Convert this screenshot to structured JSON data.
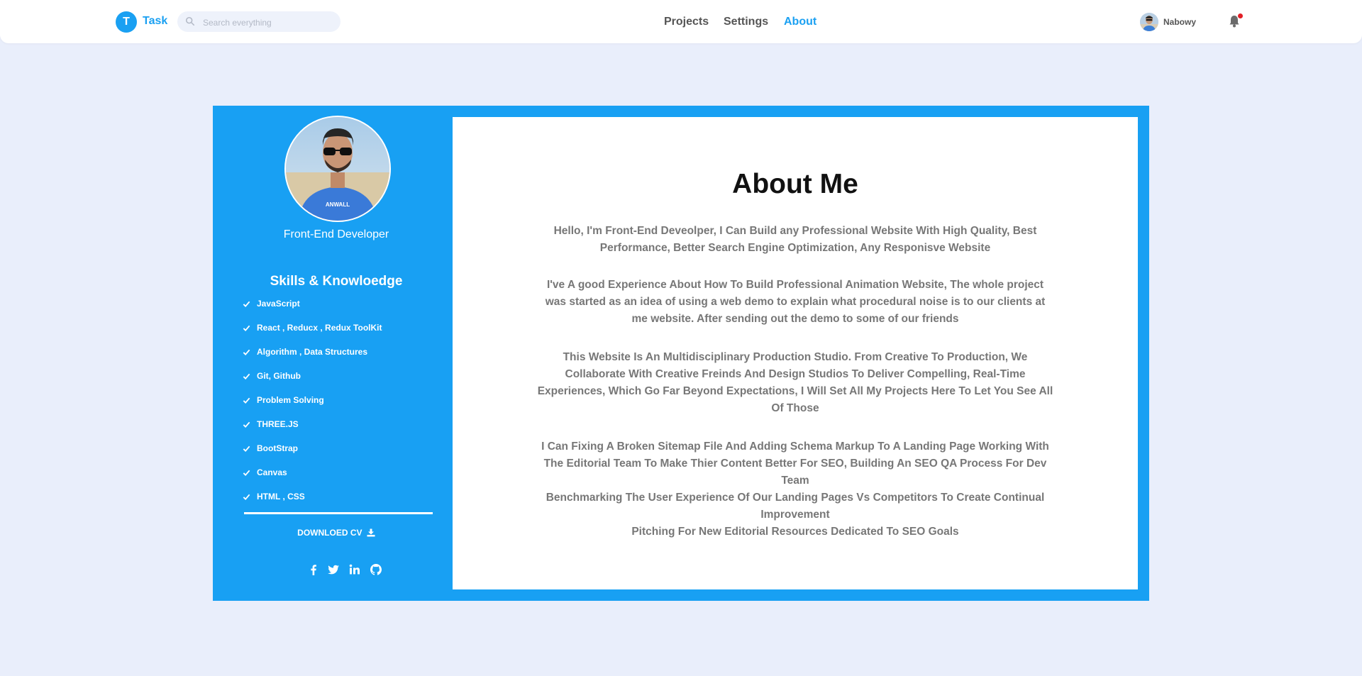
{
  "header": {
    "logo_letter": "T",
    "brand": "Task",
    "search_placeholder": "Search everything",
    "nav": [
      "Projects",
      "Settings",
      "About"
    ],
    "active_nav": "About",
    "user_name": "Nabowy"
  },
  "colors": {
    "accent": "#1aa0f2",
    "background": "#e9eefb",
    "card": "#18a0f3",
    "notification_dot": "#e21f26"
  },
  "profile": {
    "photo_shirt_text": "ANWALL",
    "role": "Front-End Developer",
    "skills_title": "Skills & Knowloedge",
    "skills": [
      "JavaScript",
      "React , Reducx , Redux ToolKit",
      "Algorithm , Data Structures",
      "Git, Github",
      "Problem Solving",
      "THREE.JS",
      "BootStrap",
      "Canvas",
      "HTML , CSS"
    ],
    "download_label": "DOWNLOED CV",
    "social_icons": [
      "facebook-icon",
      "twitter-icon",
      "linkedin-icon",
      "github-icon"
    ]
  },
  "about": {
    "title": "About Me",
    "paragraphs": [
      "Hello, I'm Front-End Deveolper, I Can Build any Professional Website With High Quality, Best Performance, Better Search Engine Optimization, Any Responisve Website",
      "I've A good Experience About How To Build Professional Animation Website, The whole project was started as an idea of using a web demo to explain what procedural noise is to our clients at me website. After sending out the demo to some of our friends",
      "This Website Is An Multidisciplinary Production Studio. From Creative To Production, We Collaborate With Creative Freinds And Design Studios To Deliver Compelling, Real-Time Experiences, Which Go Far Beyond Expectations, I Will Set All My Projects Here To Let You See All Of Those",
      "I Can Fixing A Broken Sitemap File And Adding Schema Markup To A Landing Page Working With The Editorial Team To Make Thier Content Better For SEO, Building An SEO QA Process For Dev Team",
      "Benchmarking The User Experience Of Our Landing Pages Vs Competitors To Create Continual Improvement",
      "Pitching For New Editorial Resources Dedicated To SEO Goals"
    ]
  }
}
